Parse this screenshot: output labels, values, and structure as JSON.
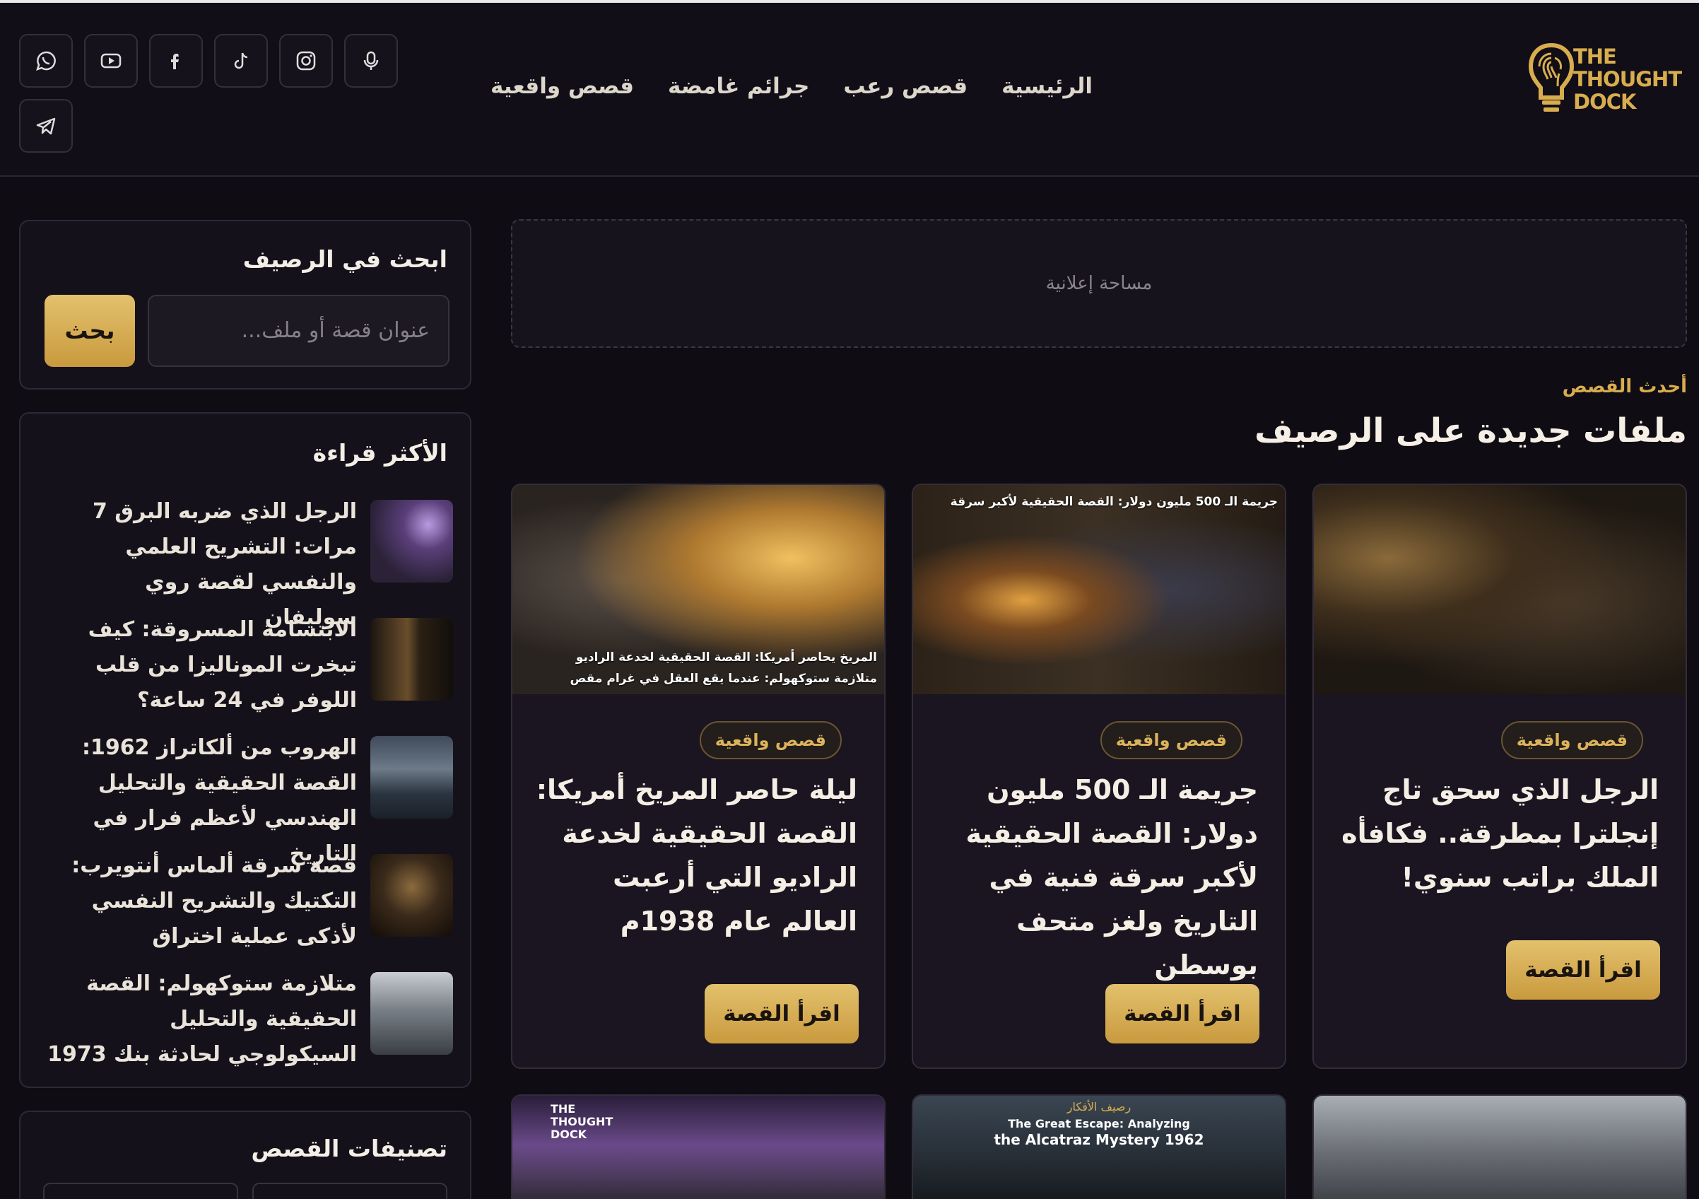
{
  "header": {
    "logo_text": "THE THOUGHT DOCK",
    "nav": [
      "الرئيسية",
      "قصص رعب",
      "جرائم غامضة",
      "قصص واقعية"
    ],
    "socials": [
      "podcast-icon",
      "instagram-icon",
      "tiktok-icon",
      "facebook-icon",
      "youtube-icon",
      "whatsapp-icon",
      "telegram-icon"
    ]
  },
  "sidebar": {
    "search": {
      "title": "ابحث في الرصيف",
      "placeholder": "عنوان قصة أو ملف...",
      "button": "بحث"
    },
    "popular": {
      "title": "الأكثر قراءة",
      "items": [
        "الرجل الذي ضربه البرق 7 مرات: التشريح العلمي والنفسي لقصة روي سوليفان",
        "الابتسامة المسروقة: كيف تبخرت الموناليزا من قلب اللوفر في 24 ساعة؟",
        "الهروب من ألكاتراز 1962: القصة الحقيقية والتحليل الهندسي لأعظم فرار في التاريخ",
        "قصة سرقة ألماس أنتويرب: التكتيك والتشريح النفسي لأذكى عملية اختراق",
        "متلازمة ستوكهولم: القصة الحقيقية والتحليل السيكولوجي لحادثة بنك 1973"
      ]
    },
    "categories": {
      "title": "تصنيفات القصص"
    }
  },
  "main": {
    "ad_label": "مساحة إعلانية",
    "kicker": "أحدث القصص",
    "section_title": "ملفات جديدة على الرصيف",
    "cards": [
      {
        "tag": "قصص واقعية",
        "title": "الرجل الذي سحق تاج إنجلترا بمطرقة.. فكافأه الملك براتب سنوي!",
        "button": "اقرأ القصة"
      },
      {
        "tag": "قصص واقعية",
        "title": "جريمة الـ 500 مليون دولار: القصة الحقيقية لأكبر سرقة فنية في التاريخ ولغز متحف بوسطن",
        "button": "اقرأ القصة",
        "image_caption": "جريمة الـ 500 مليون دولار: القصة الحقيقية لأكبر سرقة"
      },
      {
        "tag": "قصص واقعية",
        "title": "ليلة حاصر المريخ أمريكا: القصة الحقيقية لخدعة الراديو التي أرعبت العالم عام 1938م",
        "button": "اقرأ القصة",
        "image_caption_1": "المريخ يحاصر أمريكا: القصة الحقيقية لخدعة الراديو",
        "image_caption_2": "متلازمة ستوكهولم: عندما يقع العقل في غرام مقص"
      }
    ],
    "row2_captions": {
      "alcatraz_ar": "رصيف الأفكار",
      "alcatraz_line1": "The Great Escape: Analyzing",
      "alcatraz_line2": "the Alcatraz Mystery 1962",
      "logo": "THE THOUGHT DOCK"
    }
  },
  "colors": {
    "accent": "#d8ad4e",
    "background": "#0f0c14",
    "card": "#1a1520"
  }
}
